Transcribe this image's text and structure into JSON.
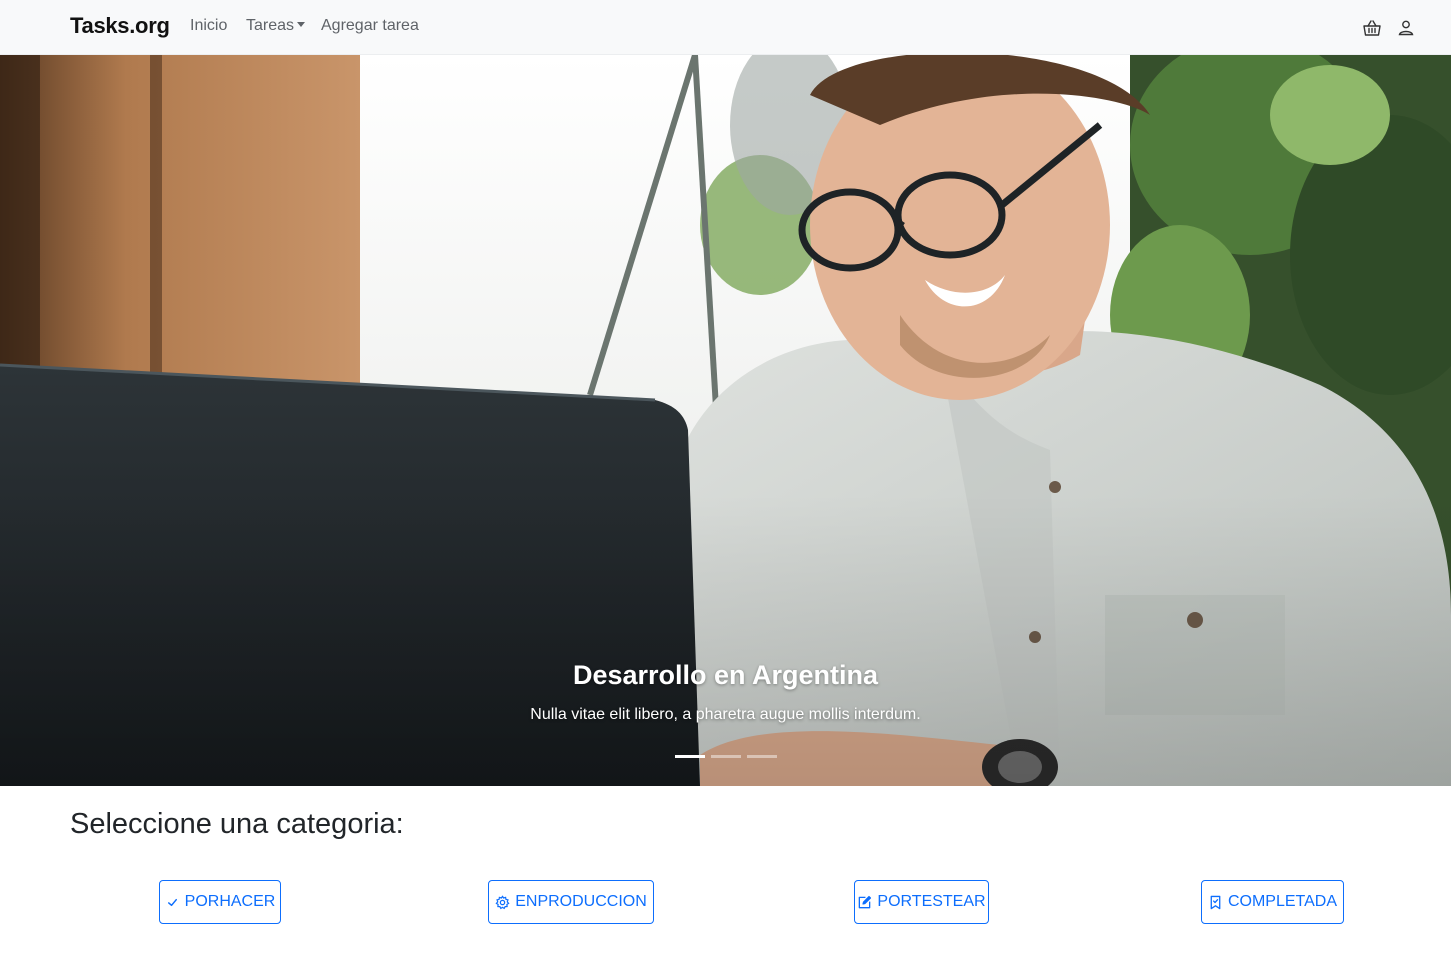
{
  "navbar": {
    "brand": "Tasks.org",
    "links": {
      "inicio": "Inicio",
      "tareas": "Tareas",
      "agregar": "Agregar tarea"
    },
    "icons": [
      "basket-icon",
      "person-icon"
    ]
  },
  "carousel": {
    "caption_title": "Desarrollo en Argentina",
    "caption_text": "Nulla vitae elit libero, a pharetra augue mollis interdum.",
    "slide_count": 3,
    "active_slide": 1
  },
  "categories": {
    "heading": "Seleccione una categoria:",
    "buttons": {
      "porhacer": "PORHACER",
      "enproduccion": "ENPRODUCCION",
      "portestear": "PORTESTEAR",
      "completada": "COMPLETADA"
    },
    "icons": [
      "check-icon",
      "gear-icon",
      "edit-icon",
      "bookmark-icon"
    ]
  },
  "colors": {
    "primary": "#0d6efd",
    "navbar_bg": "#f8f9fa",
    "text": "#212529"
  }
}
